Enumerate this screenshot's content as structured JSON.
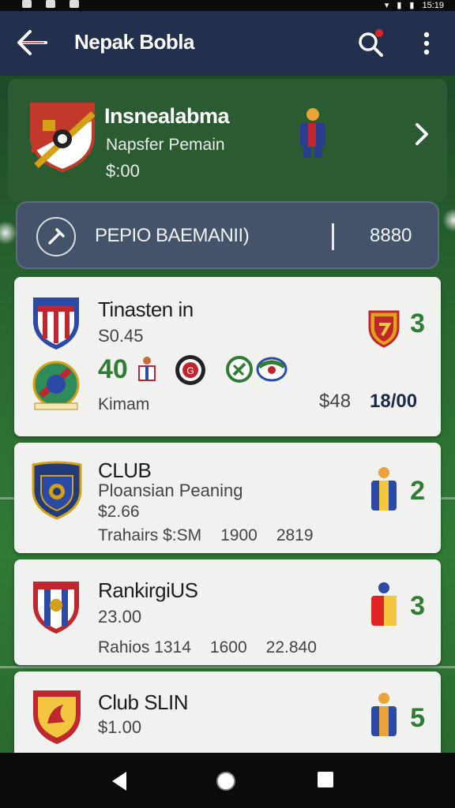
{
  "app_bar": {
    "title": "Nepak Bobla",
    "back_icon": "back-arrow-icon",
    "search_icon": "search-icon",
    "more_icon": "more-vertical-icon"
  },
  "status_bar": {
    "time": "15:19"
  },
  "hero": {
    "title": "Insnealabma",
    "subtitle": "Napsfer Pemain",
    "price": "$:00"
  },
  "search_pill": {
    "text": "PEPIO BAEMANII)",
    "number": "8880"
  },
  "cards": [
    {
      "title": "Tinasten in",
      "subtitle": "S0.45",
      "stat": "40",
      "footer": "Kimam",
      "price_a": "$48",
      "price_b": "18/00",
      "rank": "3"
    },
    {
      "title": "CLUB",
      "subtitle": "Ploansian Peaning",
      "price": "$2.66",
      "footer_cols": [
        "Trahairs $:SM",
        "1900",
        "2819"
      ],
      "rank": "2"
    },
    {
      "title": "RankirgiUS",
      "subtitle": "23.00",
      "footer_cols": [
        "Rahios 1314",
        "1600",
        "22.840"
      ],
      "rank": "3"
    },
    {
      "title": "Club SLIN",
      "subtitle": "$1.00",
      "rank": "5"
    }
  ],
  "colors": {
    "appbar": "#22304e",
    "rank_green": "#2e7d32",
    "card_bg": "#f1f1ef"
  }
}
